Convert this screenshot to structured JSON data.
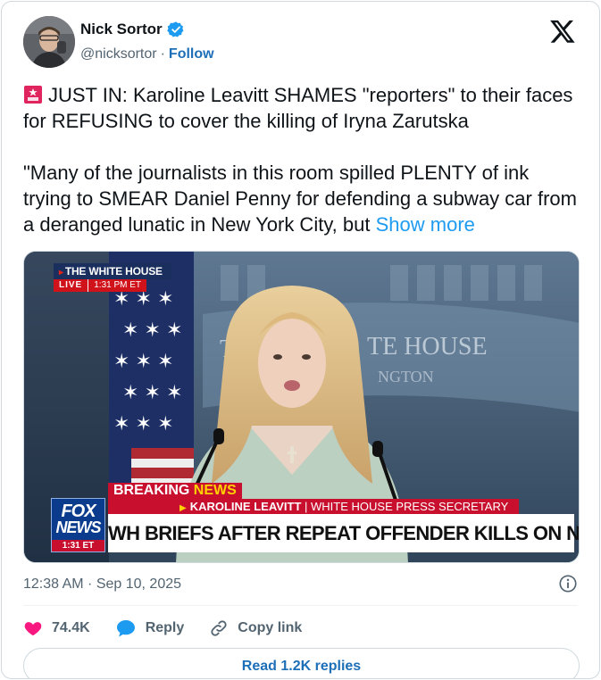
{
  "author": {
    "name": "Nick Sortor",
    "handle": "@nicksortor",
    "separator": "·",
    "follow_label": "Follow",
    "verified_color": "#1d9bf0"
  },
  "tweet": {
    "line1": "JUST IN: Karoline Leavitt SHAMES \"reporters\" to their faces for REFUSING to cover the killing of Iryna Zarutska",
    "line2": "\"Many of the journalists in this room spilled PLENTY of ink trying to SMEAR Daniel Penny for defending a subway car from a deranged lunatic in New York City, but ",
    "show_more": "Show more",
    "emoji_icon": "rotating-light-icon"
  },
  "media": {
    "wh_bug_title": "THE WHITE HOUSE",
    "wh_bug_live": "LIVE",
    "wh_bug_time": "1:31 PM ET",
    "backdrop_text_1": "T",
    "backdrop_text_2": "TE HOUSE",
    "backdrop_text_3": "NGTON",
    "breaking_1": "BREAKING ",
    "breaking_2": "NEWS",
    "speaker_name": "KAROLINE LEAVITT",
    "speaker_sep": " | ",
    "speaker_role": "WHITE HOUSE PRESS SECRETARY",
    "headline": "WH BRIEFS AFTER REPEAT OFFENDER KILLS ON NC TRAIN",
    "logo_fox": "FOX",
    "logo_news": "NEWS",
    "logo_time": "1:31 ET"
  },
  "footer": {
    "timestamp": "12:38 AM · Sep 10, 2025",
    "like_count": "74.4K",
    "reply_label": "Reply",
    "copy_label": "Copy link",
    "read_replies_label": "Read 1.2K replies"
  },
  "colors": {
    "link": "#1d9bf0",
    "heart": "#f91880",
    "accent_red": "#c8102e"
  }
}
